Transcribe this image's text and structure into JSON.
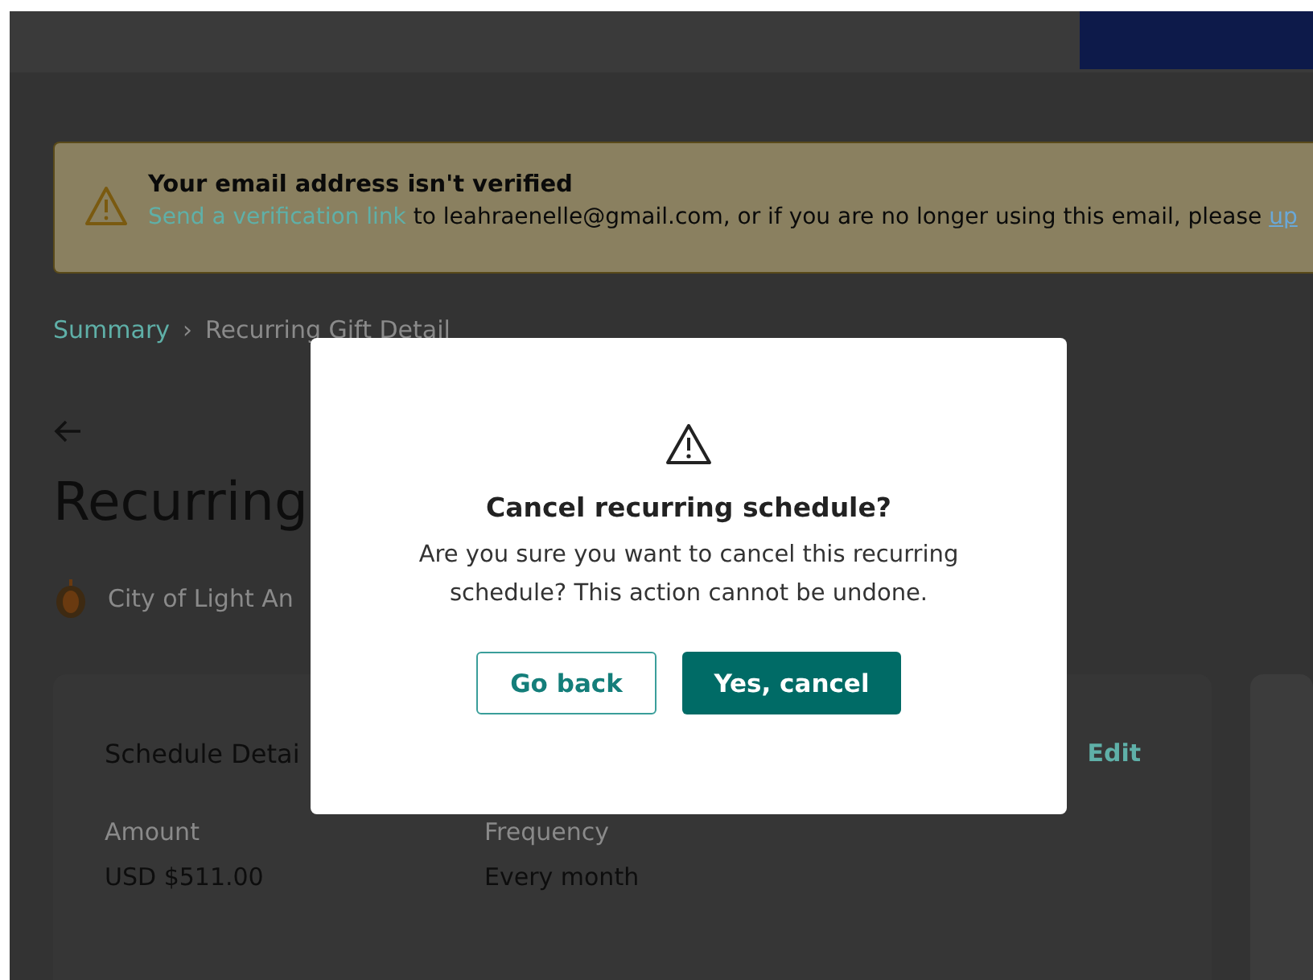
{
  "banner": {
    "title": "Your email address isn't verified",
    "link": "Send a verification link",
    "text": " to leahraenelle@gmail.com, or if you are no longer using this email, please ",
    "link_2": "up"
  },
  "breadcrumb_separator": "›",
  "breadcrumb": [
    {
      "label": "Summary",
      "kind": "link"
    },
    {
      "label": "Recurring Gift Detail",
      "kind": "current"
    }
  ],
  "page_title": "Recurring",
  "organization": "City of Light An",
  "card": {
    "title": "Schedule Detai",
    "action": "Edit",
    "fields": [
      {
        "label": "Amount",
        "value": "USD $511.00"
      },
      {
        "label": "Frequency",
        "value": "Every month"
      }
    ]
  },
  "dialog": {
    "title": "Cancel recurring schedule?",
    "message": "Are you sure you want to cancel this recurring schedule? This action cannot be undone.",
    "buttons": [
      {
        "label": "Go back",
        "kind": "secondary"
      },
      {
        "label": "Yes, cancel",
        "kind": "primary"
      }
    ]
  }
}
